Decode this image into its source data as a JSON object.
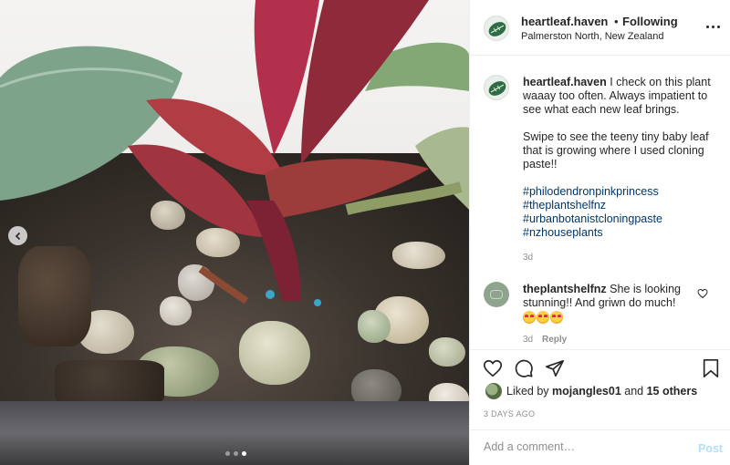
{
  "post": {
    "username": "heartleaf.haven",
    "separator": "•",
    "follow_status": "Following",
    "location": "Palmerston North, New Zealand",
    "caption_line1": "I check on this plant waaay too often. Always impatient to see what each new leaf brings.",
    "caption_line2": "Swipe to see the teeny tiny baby leaf that is growing where I used cloning paste!!",
    "hashtags": [
      "#philodendronpinkprincess",
      "#theplantshelfnz",
      "#urbanbotanistcloningpaste",
      "#nzhouseplants"
    ],
    "caption_age": "3d",
    "carousel": {
      "count": 3,
      "active_index": 2
    }
  },
  "comment": {
    "username": "theplantshelfnz",
    "text": "She is looking stunning!! And griwn do much!",
    "emoji_count": 3,
    "age": "3d",
    "reply_label": "Reply"
  },
  "likes": {
    "prefix": "Liked by",
    "user": "mojangles01",
    "conjunction": "and",
    "others": "15 others"
  },
  "date": "3 DAYS AGO",
  "add_comment": {
    "placeholder": "Add a comment…",
    "post_label": "Post"
  },
  "icons": {
    "more": "more-horizontal-icon",
    "prev": "chevron-left-icon",
    "like": "heart-icon",
    "comment": "comment-bubble-icon",
    "share": "paper-plane-icon",
    "save": "bookmark-icon"
  },
  "colors": {
    "link": "#00376b",
    "muted": "#8e8e8e",
    "post_disabled": "#b2dffc"
  }
}
